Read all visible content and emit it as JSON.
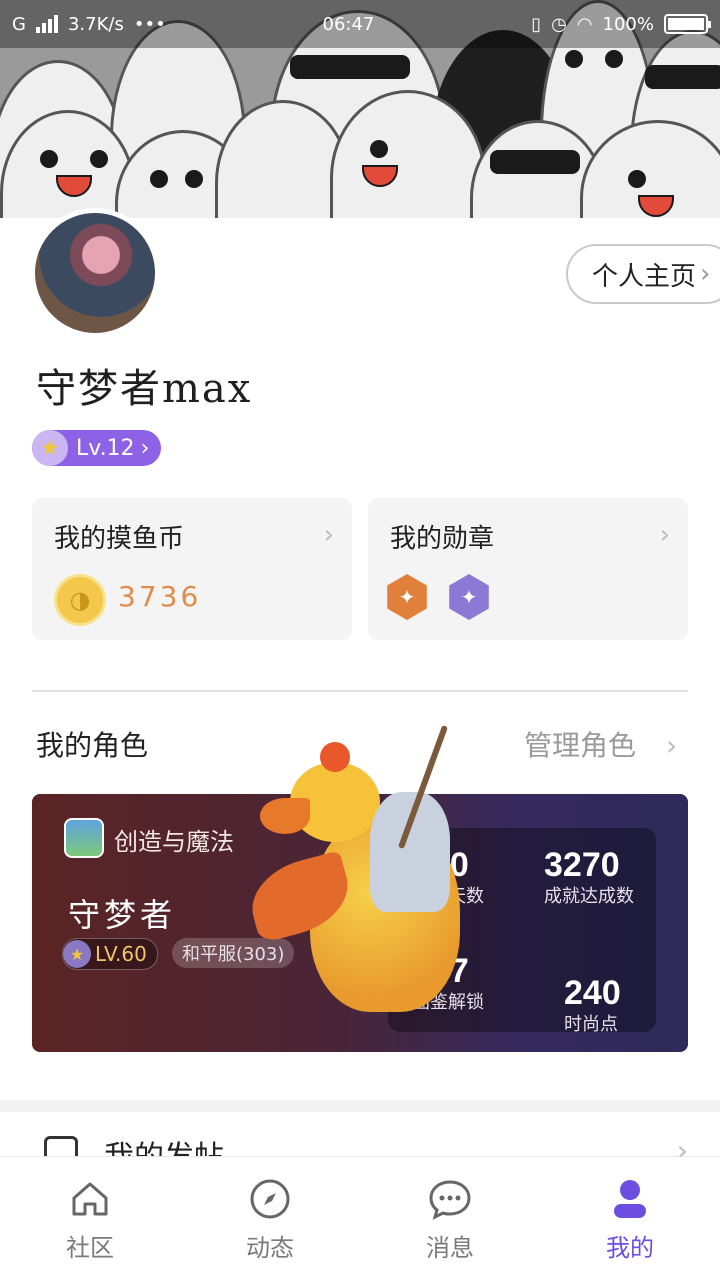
{
  "status_bar": {
    "carrier": "G",
    "speed": "3.7K/s",
    "dots": "•••",
    "time": "06:47",
    "battery": "100%"
  },
  "profile": {
    "homepage_button": "个人主页",
    "username": "守梦者max",
    "level": "Lv.12"
  },
  "cards": {
    "coins": {
      "title": "我的摸鱼币",
      "count": "3736"
    },
    "medals": {
      "title": "我的勋章",
      "icons": [
        "orange-medal-icon",
        "purple-medal-icon"
      ]
    }
  },
  "roles_section": {
    "title": "我的角色",
    "manage_label": "管理角色"
  },
  "role_card": {
    "game_name": "创造与魔法",
    "role_name": "守梦者",
    "level": "LV.60",
    "server": "和平服(303)",
    "stats": [
      {
        "value": "100",
        "label": "登录天数"
      },
      {
        "value": "3270",
        "label": "成就达成数"
      },
      {
        "value": "337",
        "label": "图鉴解锁"
      },
      {
        "value": "240",
        "label": "时尚点"
      }
    ]
  },
  "posts": {
    "label": "我的发帖"
  },
  "tabs": [
    {
      "label": "社区",
      "icon": "home-icon"
    },
    {
      "label": "动态",
      "icon": "compass-icon"
    },
    {
      "label": "消息",
      "icon": "chat-bubble-icon"
    },
    {
      "label": "我的",
      "icon": "person-icon"
    }
  ],
  "colors": {
    "accent": "#6c4fe0",
    "level_badge": "#8e62e6",
    "coin_text": "#e08c4a"
  }
}
